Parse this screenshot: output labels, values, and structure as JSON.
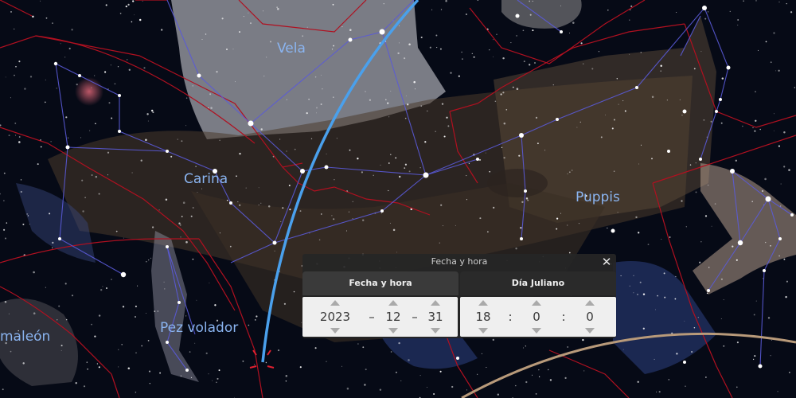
{
  "sky": {
    "constellations": [
      "Vela",
      "Carina",
      "Puppis",
      "Pez volador",
      "maleón"
    ],
    "colors": {
      "background": "#060a16",
      "constellation_line": "#5a5ad8",
      "boundary": "#b01020",
      "meridian": "#4aa0ec",
      "ecliptic": "#b89a7a",
      "label": "#8ab4f0"
    }
  },
  "dialog": {
    "title": "Fecha y hora",
    "close_icon": "close-icon",
    "tabs": {
      "date": "Fecha y hora",
      "julian": "Día Juliano"
    },
    "date": {
      "year": "2023",
      "month": "12",
      "day": "31",
      "separator": "–"
    },
    "time": {
      "hour": "18",
      "minute": "0",
      "second": "0",
      "separator": ":"
    }
  }
}
